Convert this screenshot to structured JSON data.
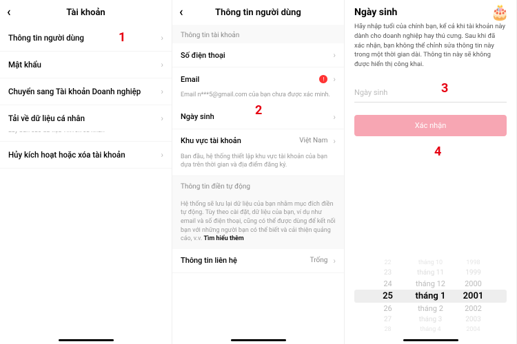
{
  "panel1": {
    "title": "Tài khoản",
    "items": [
      {
        "label": "Thông tin người dùng"
      },
      {
        "label": "Mật khẩu"
      },
      {
        "label": "Chuyển sang Tài khoản Doanh nghiệp"
      },
      {
        "label": "Tải về dữ liệu cá nhân",
        "sub": "Lấy bản sao dữ liệu TikTok cá nhân"
      },
      {
        "label": "Hủy kích hoạt hoặc xóa tài khoản"
      }
    ],
    "annotation": "1"
  },
  "panel2": {
    "title": "Thông tin người dùng",
    "section1_label": "Thông tin tài khoản",
    "rows": {
      "phone": {
        "label": "Số điện thoại"
      },
      "email": {
        "label": "Email",
        "sub": "Email n***5@gmail.com của bạn chưa được xác minh."
      },
      "birthday": {
        "label": "Ngày sinh"
      },
      "region": {
        "label": "Khu vực tài khoản",
        "value": "Việt Nam",
        "sub": "Ban đầu, hệ thống thiết lập khu vực tài khoản của bạn dựa trên thời gian và địa điểm đăng ký."
      }
    },
    "section2_label": "Thông tin điền tự động",
    "section2_desc": "Hệ thống sẽ lưu lại dữ liệu của bạn nhằm mục đích điền tự động. Tùy theo cài đặt, dữ liệu của bạn, ví dụ như email và số điện thoại, cũng có thể được dùng để kết nối bạn với những người bạn có thể biết và cải thiện quảng cáo, v.v.",
    "section2_link": "Tìm hiểu thêm",
    "contact": {
      "label": "Thông tin liên hệ",
      "value": "Trống"
    },
    "annotation": "2"
  },
  "panel3": {
    "title": "Ngày sinh",
    "desc": "Hãy nhập tuổi của chính bạn, kể cả khi tài khoản này dành cho doanh nghiệp hay thú cưng. Sau khi đã xác nhận, bạn không thể chỉnh sửa thông tin này trong một thời gian dài. Thông tin này sẽ không được hiển thị công khai.",
    "placeholder": "Ngày sinh",
    "button": "Xác nhận",
    "picker": {
      "rows": [
        {
          "d": "22",
          "m": "tháng 10",
          "y": "1998",
          "cls": "f2"
        },
        {
          "d": "23",
          "m": "tháng 11",
          "y": "1999",
          "cls": "faded"
        },
        {
          "d": "24",
          "m": "tháng 12",
          "y": "2000",
          "cls": ""
        },
        {
          "d": "25",
          "m": "tháng 1",
          "y": "2001",
          "cls": "sel"
        },
        {
          "d": "26",
          "m": "tháng 2",
          "y": "2002",
          "cls": ""
        },
        {
          "d": "27",
          "m": "tháng 3",
          "y": "2003",
          "cls": "faded"
        },
        {
          "d": "28",
          "m": "tháng 4",
          "y": "2004",
          "cls": "f2"
        }
      ]
    },
    "annotation3": "3",
    "annotation4": "4"
  }
}
